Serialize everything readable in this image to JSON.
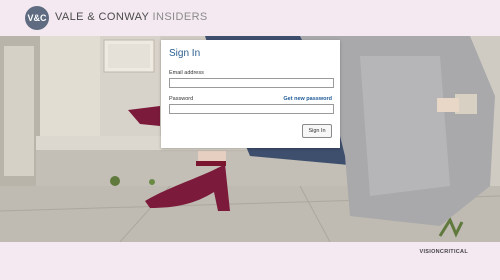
{
  "header": {
    "logo_text": "V&C",
    "brand_main": "VALE & CONWAY",
    "brand_suffix": "INSIDERS"
  },
  "signin": {
    "title": "Sign In",
    "email_label": "Email address",
    "email_value": "",
    "password_label": "Password",
    "password_value": "",
    "forgot_link": "Get new password",
    "submit_label": "Sign In"
  },
  "footer": {
    "powered_by": "VISIONCRITICAL"
  },
  "colors": {
    "page_background": "#f4e9f1",
    "title_blue": "#2a5d8f",
    "shoe_burgundy": "#7b1a3a"
  }
}
